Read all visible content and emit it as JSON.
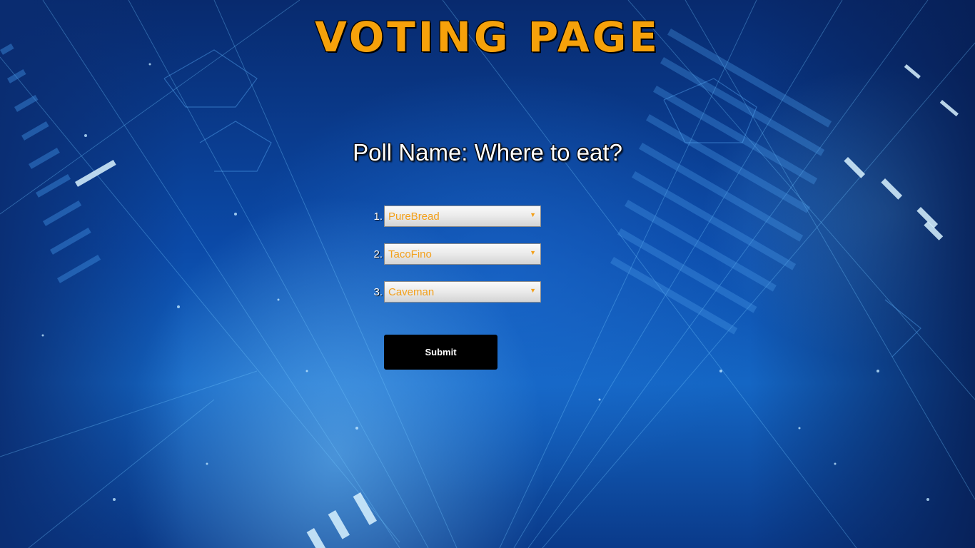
{
  "header": {
    "title": "VOTING PAGE"
  },
  "poll": {
    "name_text": "Poll Name: Where to eat?"
  },
  "choices": [
    {
      "number": "1.",
      "selected": "PureBread"
    },
    {
      "number": "2.",
      "selected": "TacoFino"
    },
    {
      "number": "3.",
      "selected": "Caveman"
    }
  ],
  "form": {
    "submit_label": "Submit"
  },
  "colors": {
    "title": "#f6a10a",
    "select_text": "#f3a01a",
    "button_bg": "#000000",
    "background": "#0b4aa8"
  },
  "icons": {
    "dropdown": "triangle-down"
  }
}
